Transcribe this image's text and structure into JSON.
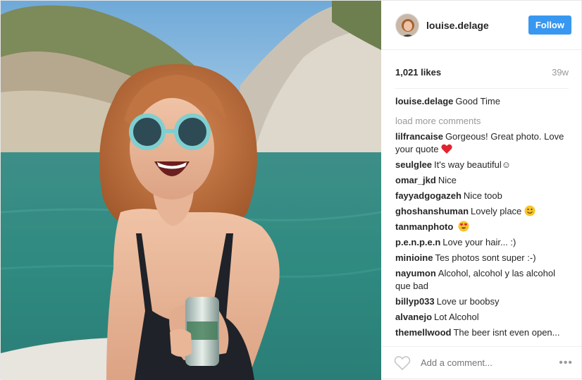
{
  "header": {
    "username": "louise.delage",
    "follow_label": "Follow"
  },
  "meta": {
    "likes": "1,021 likes",
    "time_ago": "39w"
  },
  "caption": {
    "user": "louise.delage",
    "text": "Good Time"
  },
  "load_more": "load more comments",
  "comments": [
    {
      "user": "lilfrancaise",
      "text": "Gorgeous! Great photo. Love your quote",
      "emoji": "heart-emoji"
    },
    {
      "user": "seulglee",
      "text": "It's way beautiful☺"
    },
    {
      "user": "omar_jkd",
      "text": "Nice"
    },
    {
      "user": "fayyadgogazeh",
      "text": "Nice toob"
    },
    {
      "user": "ghoshanshuman",
      "text": "Lovely place",
      "emoji": "smile-emoji"
    },
    {
      "user": "tanmanphoto",
      "text": "",
      "emoji": "heart-eyes-emoji"
    },
    {
      "user": "p.e.n.p.e.n",
      "text": "Love your hair... :)"
    },
    {
      "user": "minioine",
      "text": "Tes photos sont super :-)"
    },
    {
      "user": "nayumon",
      "text": "Alcohol, alcohol y las alcohol que bad"
    },
    {
      "user": "billyp033",
      "text": "Love ur boobsy"
    },
    {
      "user": "alvanejo",
      "text": "Lot Alcohol"
    },
    {
      "user": "themellwood",
      "text": "The beer isnt even open..."
    }
  ],
  "footer": {
    "comment_placeholder": "Add a comment...",
    "more_label": "•••"
  },
  "icons": {
    "like": "heart-outline-icon",
    "more": "more-options-icon"
  },
  "colors": {
    "accent": "#3897f0",
    "muted": "#999999",
    "text": "#262626"
  }
}
